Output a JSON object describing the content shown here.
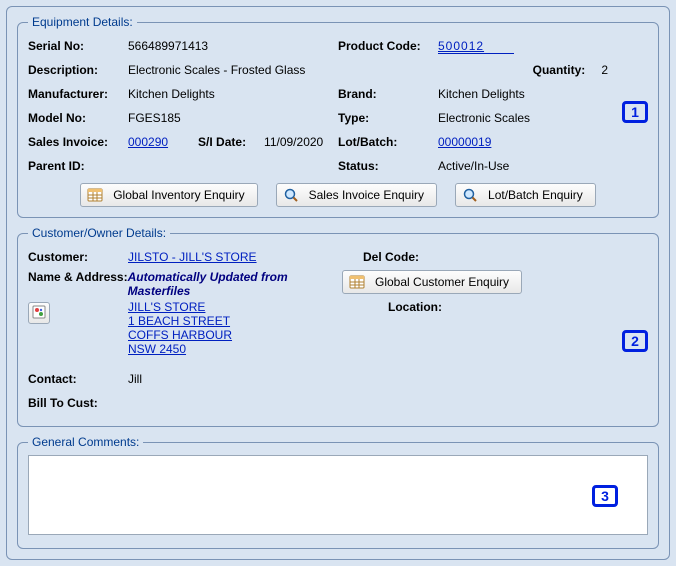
{
  "equipment": {
    "legend": "Equipment Details:",
    "serial_lbl": "Serial No:",
    "serial": "566489971413",
    "product_code_lbl": "Product Code:",
    "product_code": "500012",
    "description_lbl": "Description:",
    "description": "Electronic Scales - Frosted Glass",
    "quantity_lbl": "Quantity:",
    "quantity": "2",
    "manufacturer_lbl": "Manufacturer:",
    "manufacturer": "Kitchen Delights",
    "brand_lbl": "Brand:",
    "brand": "Kitchen Delights",
    "model_lbl": "Model No:",
    "model": "FGES185",
    "type_lbl": "Type:",
    "type": "Electronic Scales",
    "sales_invoice_lbl": "Sales Invoice:",
    "sales_invoice": "000290",
    "si_date_lbl": "S/I Date:",
    "si_date": "11/09/2020",
    "lot_batch_lbl": "Lot/Batch:",
    "lot_batch": "00000019",
    "parent_lbl": "Parent ID:",
    "status_lbl": "Status:",
    "status": "Active/In-Use",
    "btn_inventory": "Global Inventory Enquiry",
    "btn_invoice": "Sales Invoice Enquiry",
    "btn_lotbatch": "Lot/Batch Enquiry"
  },
  "customer": {
    "legend": "Customer/Owner Details:",
    "customer_lbl": "Customer:",
    "customer": "JILSTO - JILL'S STORE",
    "del_code_lbl": "Del Code:",
    "name_addr_lbl": "Name & Address:",
    "auto_msg": "Automatically Updated from Masterfiles",
    "btn_customer": "Global Customer Enquiry",
    "addr1": "JILL'S STORE",
    "addr2": "1 BEACH STREET",
    "addr3": "COFFS HARBOUR",
    "addr4": "NSW 2450",
    "location_lbl": "Location:",
    "contact_lbl": "Contact:",
    "contact": "Jill",
    "bill_to_lbl": "Bill To Cust:"
  },
  "comments": {
    "legend": "General Comments:",
    "value": ""
  },
  "callouts": {
    "one": "1",
    "two": "2",
    "three": "3"
  }
}
